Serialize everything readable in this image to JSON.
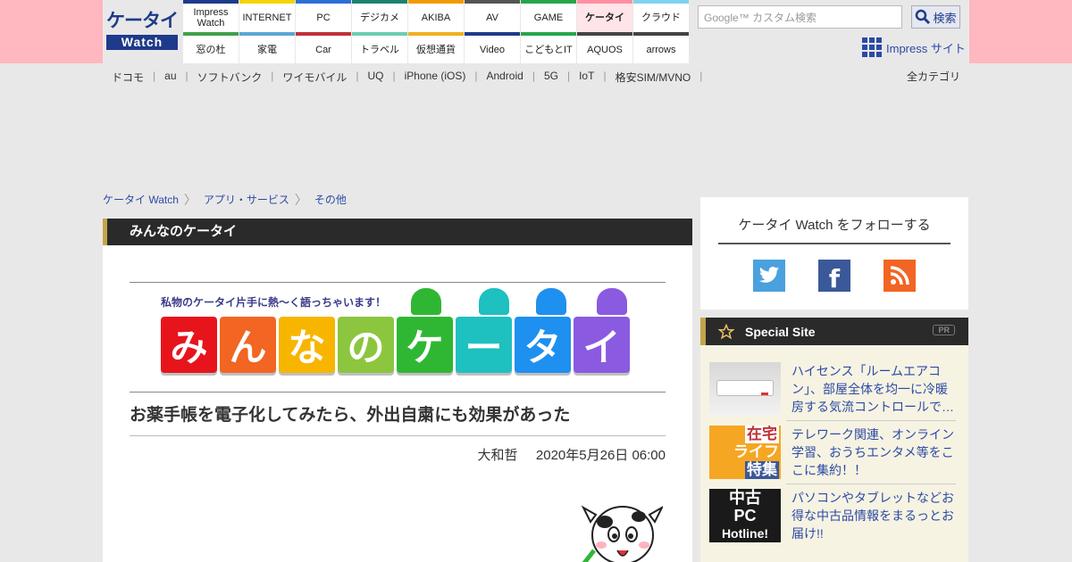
{
  "header": {
    "logo_top": "ケータイ",
    "logo_bottom": "Watch",
    "nav_row1": [
      {
        "label": "Impress\nWatch",
        "color": "#1e3a8a"
      },
      {
        "label": "INTERNET",
        "color": "#f5d400"
      },
      {
        "label": "PC",
        "color": "#2c6fd6"
      },
      {
        "label": "デジカメ",
        "color": "#19836f"
      },
      {
        "label": "AKIBA",
        "color": "#f29a00"
      },
      {
        "label": "AV",
        "color": "#555555"
      },
      {
        "label": "GAME",
        "color": "#26a64a"
      },
      {
        "label": "ケータイ",
        "color": "#ff8fa3"
      },
      {
        "label": "クラウド",
        "color": "#7fd2ef"
      }
    ],
    "nav_row2": [
      {
        "label": "窓の杜",
        "color": "#40a04a"
      },
      {
        "label": "家電",
        "color": "#5aa7d6"
      },
      {
        "label": "Car",
        "color": "#c0303a"
      },
      {
        "label": "トラベル",
        "color": "#6ccdb0"
      },
      {
        "label": "仮想通貨",
        "color": "#f0b020"
      },
      {
        "label": "Video",
        "color": "#1e3a8a"
      },
      {
        "label": "こどもとIT",
        "color": "#26a64a"
      },
      {
        "label": "AQUOS",
        "color": "#444444"
      },
      {
        "label": "arrows",
        "color": "#444444"
      }
    ],
    "active_nav": "ケータイ",
    "search_placeholder": "Google™ カスタム検索",
    "search_button": "検索",
    "impress_site": "Impress サイト"
  },
  "subnav": {
    "items": [
      "ドコモ",
      "au",
      "ソフトバンク",
      "ワイモバイル",
      "UQ",
      "iPhone (iOS)",
      "Android",
      "5G",
      "IoT",
      "格安SIM/MVNO"
    ],
    "all_categories": "全カテゴリ"
  },
  "breadcrumb": [
    "ケータイ Watch",
    "アプリ・サービス",
    "その他"
  ],
  "article": {
    "section": "みんなのケータイ",
    "banner_tagline": "私物のケータイ片手に熱～く語っちゃいます！",
    "banner_chars": [
      {
        "ch": "み",
        "color": "#e8141c"
      },
      {
        "ch": "ん",
        "color": "#f26522"
      },
      {
        "ch": "な",
        "color": "#f8b500"
      },
      {
        "ch": "の",
        "color": "#8cc63f"
      },
      {
        "ch": "ケ",
        "color": "#2fb734"
      },
      {
        "ch": "ー",
        "color": "#1ec0c0"
      },
      {
        "ch": "タ",
        "color": "#1e90ef"
      },
      {
        "ch": "イ",
        "color": "#8a5ae0"
      }
    ],
    "title": "お薬手帳を電子化してみたら、外出自粛にも効果があった",
    "author": "大和哲",
    "date": "2020年5月26日 06:00"
  },
  "sidebar": {
    "follow_title": "ケータイ Watch をフォローする",
    "social": [
      {
        "name": "twitter",
        "color": "#4aa1dd"
      },
      {
        "name": "facebook",
        "color": "#3b5998"
      },
      {
        "name": "rss",
        "color": "#f26522"
      }
    ],
    "special_title": "Special Site",
    "pr_label": "PR",
    "special_items": [
      {
        "text": "ハイセンス「ルームエアコン」、部屋全体を均一に冷暖房する気流コントロールで…"
      },
      {
        "text": "テレワーク関連、オンライン学習、おうちエンタメ等をここに集約！！",
        "thumb_lines": [
          "在宅",
          "ライフ",
          "特集"
        ]
      },
      {
        "text": "パソコンやタブレットなどお得な中古品情報をまるっとお届け!!",
        "thumb_lines": [
          "中古",
          "PC",
          "Hotline!"
        ]
      }
    ]
  }
}
